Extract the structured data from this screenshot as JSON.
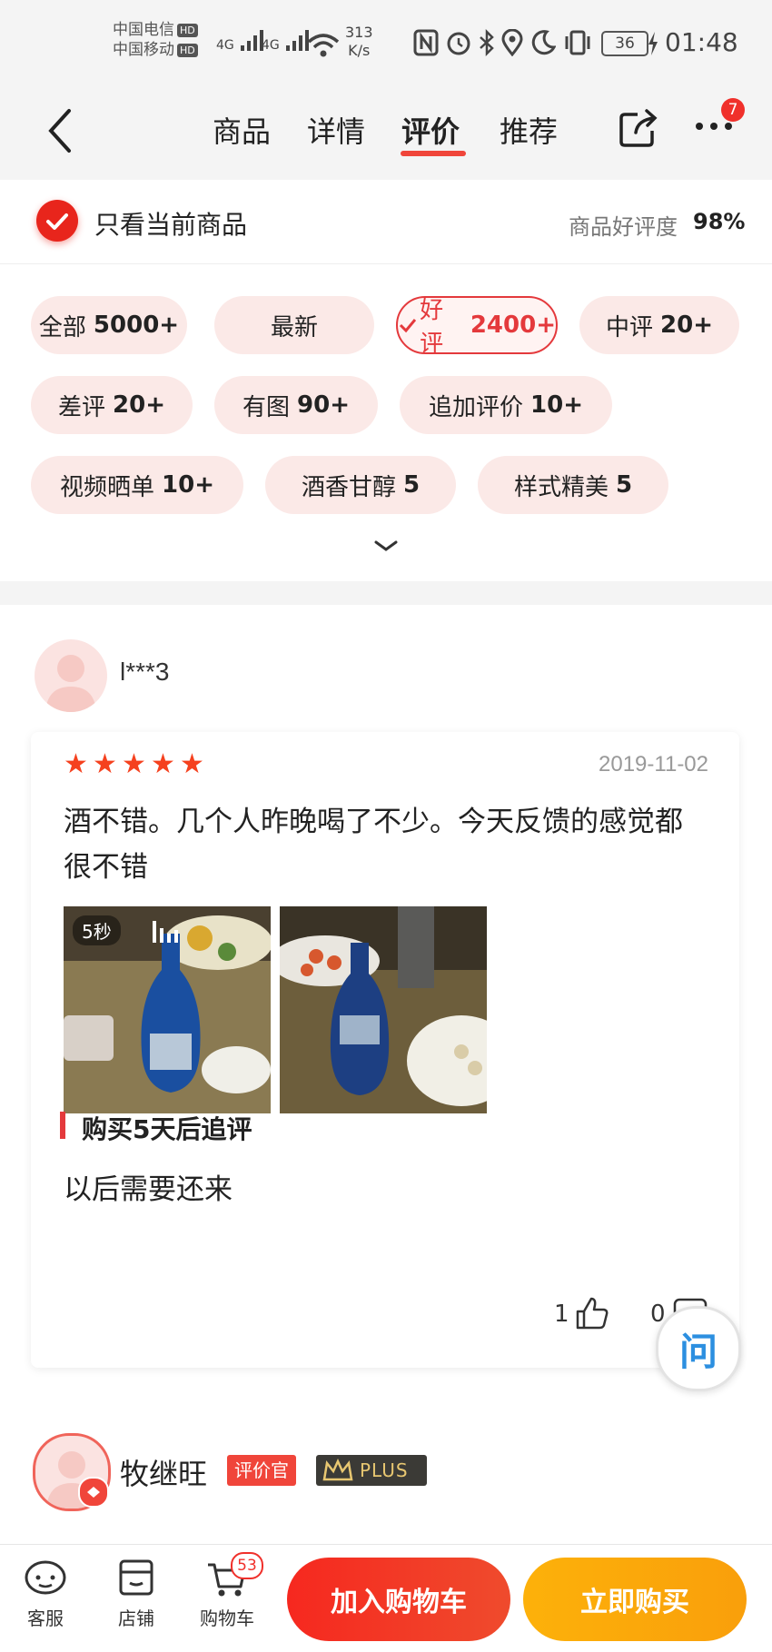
{
  "status_bar": {
    "carrier1": "中国电信",
    "carrier2": "中国移动",
    "hd": "HD",
    "net1": "4G",
    "net2": "4G",
    "speed": "313",
    "speed_unit": "K/s",
    "battery": "36",
    "time": "01:48"
  },
  "nav": {
    "tabs": [
      "商品",
      "详情",
      "评价",
      "推荐"
    ],
    "active_tab": "评价",
    "more_badge": "7"
  },
  "filter": {
    "only_current_label": "只看当前商品",
    "rating_label": "商品好评度",
    "rating_value": "98%"
  },
  "chips": [
    {
      "label": "全部",
      "count": "5000+"
    },
    {
      "label": "最新",
      "count": ""
    },
    {
      "label": "好评",
      "count": "2400+"
    },
    {
      "label": "中评",
      "count": "20+"
    },
    {
      "label": "差评",
      "count": "20+"
    },
    {
      "label": "有图",
      "count": "90+"
    },
    {
      "label": "追加评价",
      "count": "10+"
    },
    {
      "label": "视频晒单",
      "count": "10+"
    },
    {
      "label": "酒香甘醇",
      "count": "5"
    },
    {
      "label": "样式精美",
      "count": "5"
    }
  ],
  "review1": {
    "username": "l***3",
    "stars": 5,
    "date": "2019-11-02",
    "text": "酒不错。几个人昨晚喝了不少。今天反馈的感觉都很不错",
    "video_duration": "5秒",
    "followup_title": "购买5天后追评",
    "followup_text": "以后需要还来",
    "likes": "1",
    "comments": "0"
  },
  "review2": {
    "username": "牧继旺",
    "badge": "评价官",
    "plus": "PLUS"
  },
  "float_button": "问",
  "bottom_bar": {
    "service": "客服",
    "shop": "店铺",
    "cart": "购物车",
    "cart_badge": "53",
    "add_cart": "加入购物车",
    "buy_now": "立即购买"
  }
}
